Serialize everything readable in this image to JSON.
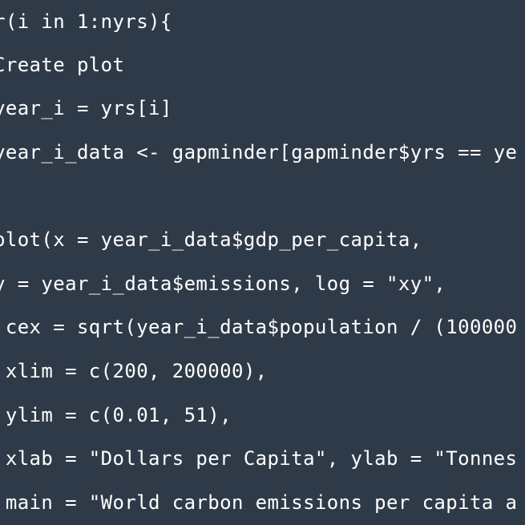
{
  "editor": {
    "background": "#2f3a48",
    "text_color": "#ffffff",
    "lines": [
      "r(i in 1:nyrs){",
      "Create plot",
      "year_i = yrs[i]",
      "year_i_data <- gapminder[gapminder$yrs == ye",
      "",
      "plot(x = year_i_data$gdp_per_capita,",
      "y = year_i_data$emissions, log = \"xy\",",
      " cex = sqrt(year_i_data$population / (100000",
      " xlim = c(200, 200000),",
      " ylim = c(0.01, 51),",
      " xlab = \"Dollars per Capita\", ylab = \"Tonnes",
      " main = \"World carbon emissions per capita a"
    ]
  }
}
